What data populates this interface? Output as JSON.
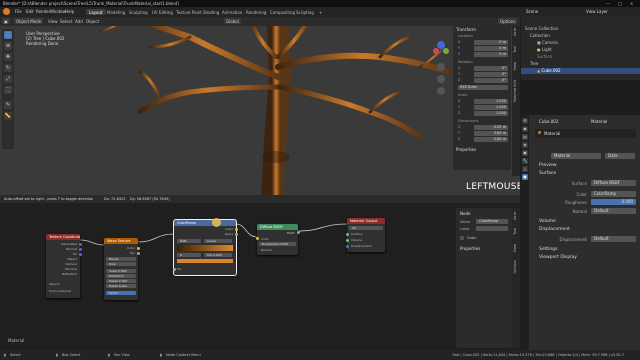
{
  "window": {
    "title": "Blender* [D:\\ABlender project\\Scene\\Tree\\L5\\Trunk_Material\\TrunkMaterial_start1.blend]",
    "controls": [
      "—",
      "□",
      "✕"
    ]
  },
  "menu": [
    "File",
    "Edit",
    "Render",
    "Window",
    "Help"
  ],
  "workspaces": [
    "Layout",
    "Modeling",
    "Sculpting",
    "UV Editing",
    "Texture Paint",
    "Shading",
    "Animation",
    "Rendering",
    "Compositing",
    "Scripting",
    "+"
  ],
  "active_workspace": "Layout",
  "top_right": {
    "scene": "Scene",
    "view_layer": "View Layer"
  },
  "viewport": {
    "mode": "Object Mode",
    "menus": [
      "View",
      "Select",
      "Add",
      "Object"
    ],
    "orientation": "Global",
    "options_label": "Options",
    "info": [
      "User Perspective",
      "(2) Tree | Cube.002",
      "Rendering Done"
    ],
    "overlay_text": "LEFTMOUSE",
    "tools": [
      "cursor-tool",
      "move-tool",
      "rotate-tool",
      "scale-tool",
      "transform-tool",
      "annotate-tool",
      "measure-tool"
    ]
  },
  "transform_panel": {
    "header": "Transform",
    "location_label": "Location",
    "location": [
      {
        "axis": "X",
        "value": "0 m"
      },
      {
        "axis": "Y",
        "value": "0 m"
      },
      {
        "axis": "Z",
        "value": "0 m"
      }
    ],
    "rotation_label": "Rotation",
    "rotation": [
      {
        "axis": "X",
        "value": "0°"
      },
      {
        "axis": "Y",
        "value": "0°"
      },
      {
        "axis": "Z",
        "value": "0°"
      }
    ],
    "mode_label": "XYZ Euler",
    "scale_label": "Scale",
    "scale": [
      {
        "axis": "X",
        "value": "1.000"
      },
      {
        "axis": "Y",
        "value": "1.000"
      },
      {
        "axis": "Z",
        "value": "1.000"
      }
    ],
    "dimensions_label": "Dimensions",
    "dimensions": [
      {
        "axis": "X",
        "value": "4.25 m"
      },
      {
        "axis": "Y",
        "value": "3.89 m"
      },
      {
        "axis": "Z",
        "value": "3.89 m"
      }
    ],
    "properties_label": "Properties"
  },
  "sidebar_tabs": [
    "Item",
    "Tool",
    "View",
    "Material Edit"
  ],
  "drag_status": {
    "hint": "Auto-offset set to right - press T to toggle direction",
    "dx": "Dx: 72.8423",
    "dy": "Dy: 58.8587 (92.7849)"
  },
  "outliner": {
    "rows": [
      {
        "label": "Scene Collection",
        "selected": false
      },
      {
        "label": "Collection",
        "selected": false
      },
      {
        "label": "Camera",
        "selected": false
      },
      {
        "label": "Light",
        "selected": false
      },
      {
        "label": "Surface",
        "selected": false
      },
      {
        "label": "Tree",
        "selected": false
      },
      {
        "label": "Cube.002",
        "selected": true
      }
    ]
  },
  "properties": {
    "object_name": "Cube.002",
    "material_name": "Material",
    "slot_label": "Material",
    "data_label": "Data",
    "preview_label": "Preview",
    "surface_label": "Surface",
    "surface_value": "Diffuse BSDF",
    "color_label": "Color",
    "color_value": "ColorRamp",
    "roughness_label": "Roughness",
    "roughness_value": "0.000",
    "normal_label": "Normal",
    "normal_value": "Default",
    "volume_label": "Volume",
    "displacement_section_label": "Displacement",
    "displacement_label": "Displacement",
    "displacement_value": "Default",
    "settings_label": "Settings",
    "viewport_display_label": "Viewport Display"
  },
  "node_editor": {
    "nodes": [
      {
        "id": "texcoord",
        "title": "Texture Coordinate",
        "color": "#8d2c2c",
        "rows": [
          "Generated",
          "Normal",
          "UV",
          "Object",
          "Camera",
          "Window",
          "Reflection",
          "Object:",
          "From Instancer"
        ]
      },
      {
        "id": "wave",
        "title": "Wave Texture",
        "color": "#b35900",
        "rows": [
          "Color",
          "Fac",
          "Bands",
          "Sine",
          "Scale 5.000",
          "Distortion",
          "Detail 2.000",
          "Detail Scale",
          "Vector"
        ]
      },
      {
        "id": "colorramp",
        "title": "ColorRamp",
        "color": "#4b69a1",
        "rows": [
          "Color",
          "Alpha",
          "RGB",
          "Linear",
          "0",
          "Pos 0.000",
          "Fac"
        ]
      },
      {
        "id": "diffuse",
        "title": "Diffuse BSDF",
        "color": "#3f8b5e",
        "rows": [
          "BSDF",
          "Color",
          "Roughness 0.000",
          "Normal"
        ]
      },
      {
        "id": "output",
        "title": "Material Output",
        "color": "#8d2c2c",
        "rows": [
          "All",
          "Surface",
          "Volume",
          "Displacement"
        ]
      }
    ],
    "frame_label": "Material",
    "side_panel": {
      "header": "Node",
      "name_label": "Name",
      "name_value": "ColorRamp",
      "label_label": "Label",
      "color_label": "Color",
      "properties_label": "Properties"
    },
    "side_tabs": [
      "Item",
      "Tool",
      "View",
      "Options"
    ]
  },
  "statusbar": {
    "left": [
      {
        "icon": "mouse-left-icon",
        "label": "Select"
      },
      {
        "icon": "mouse-middle-icon",
        "label": "Box Select"
      },
      {
        "icon": "mouse-right-icon",
        "label": "Pan View"
      },
      {
        "icon": "menu-icon",
        "label": "Node Context Menu"
      }
    ],
    "right": "Tree | Cube.002 | Verts:11,644 | Faces:10,378 | Tris:20,868 | Objects:1/4 | Mem: 59.7 MiB | v2.82.7"
  }
}
